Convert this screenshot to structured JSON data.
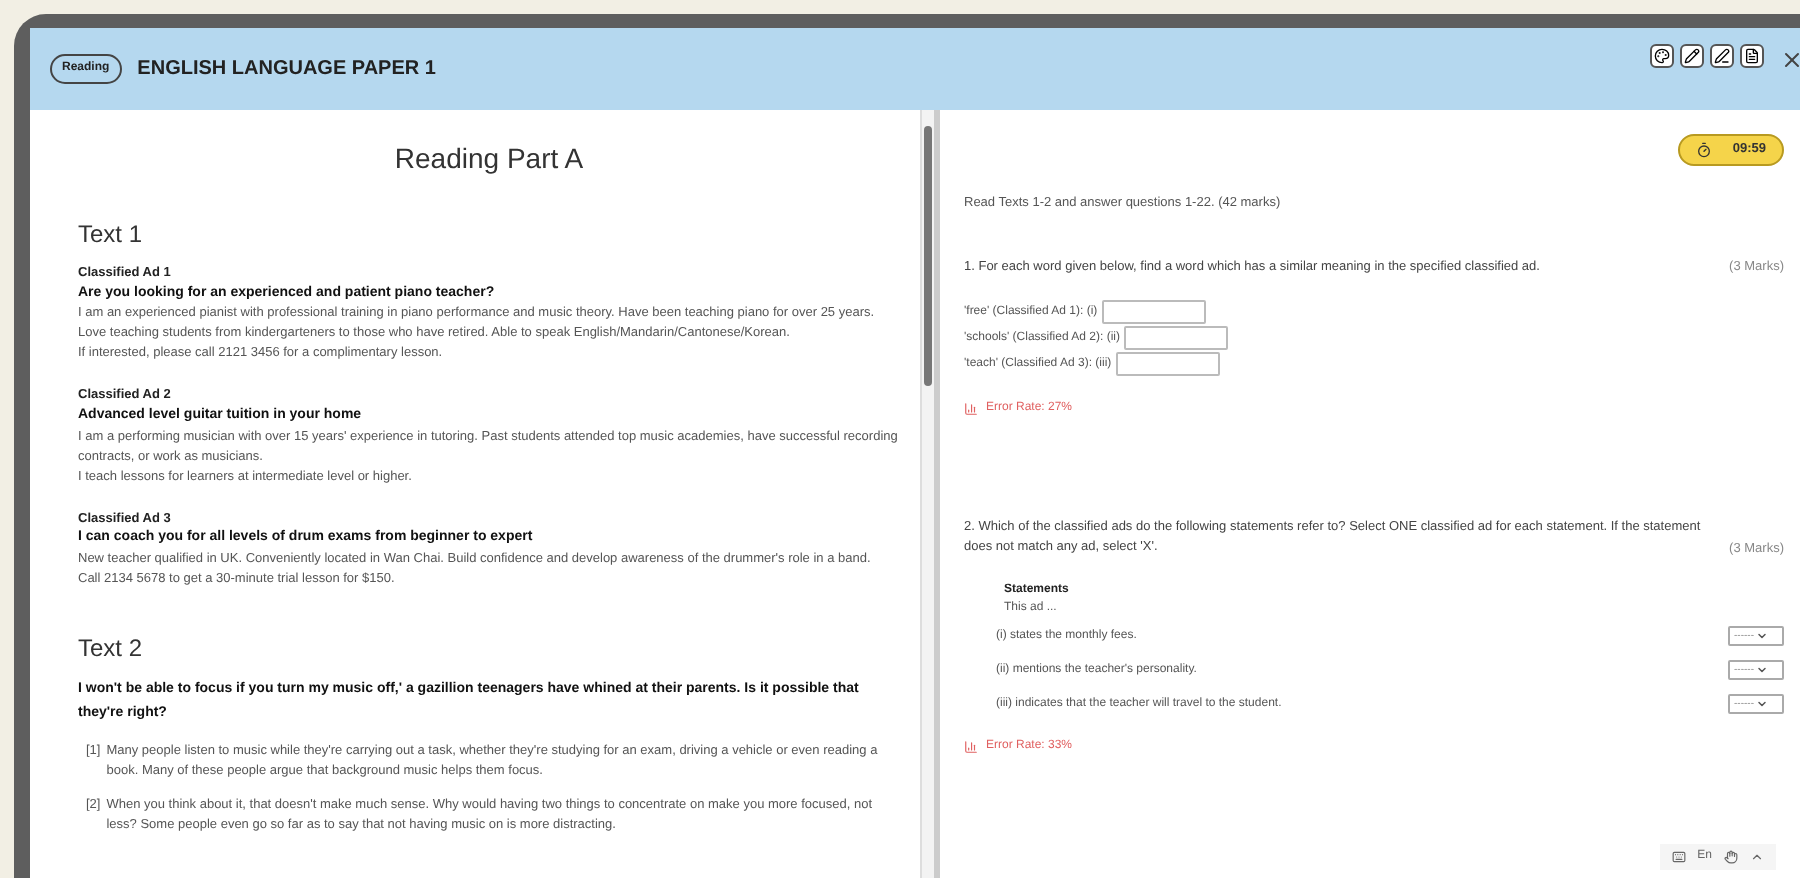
{
  "header": {
    "badge": "Reading",
    "title": "ENGLISH LANGUAGE PAPER 1"
  },
  "passage": {
    "title": "Reading Part A",
    "sections": [
      {
        "heading": "Text 1",
        "blocks": [
          {
            "kind": "ad",
            "label": "Classified Ad 1",
            "headline": "Are you looking for an experienced and patient piano teacher?",
            "lines": [
              "I am an experienced pianist with professional training in piano performance and music theory. Have been teaching piano for over 25 years. Love teaching students from kindergarteners to those who have retired. Able to speak English/Mandarin/Cantonese/Korean.",
              "If interested, please call 2121 3456 for a complimentary lesson."
            ]
          },
          {
            "kind": "ad",
            "label": "Classified Ad 2",
            "headline": "Advanced level guitar tuition in your home",
            "lines": [
              "I am a performing musician with over 15 years' experience in tutoring. Past students attended top music academies, have successful recording contracts, or work as musicians.",
              "I teach lessons for learners at intermediate level or higher."
            ]
          },
          {
            "kind": "ad",
            "label": "Classified Ad 3",
            "headline": "I can coach you for all levels of drum exams from beginner to expert",
            "lines": [
              "New teacher qualified in UK. Conveniently located in Wan Chai. Build confidence and develop awareness of the drummer's role in a band.",
              "Call 2134 5678 to get a 30-minute trial lesson for $150."
            ]
          }
        ]
      },
      {
        "heading": "Text 2",
        "blocks": [
          {
            "kind": "lead",
            "text": "I won't be able to focus if you turn my music off,' a gazillion teenagers have whined at their parents. Is it possible that they're right?"
          },
          {
            "kind": "para",
            "number": "[1]",
            "text": "Many people listen to music while they're carrying out a task, whether they're studying for an exam, driving a vehicle or even reading a book. Many of these people argue that background music helps them focus."
          },
          {
            "kind": "para",
            "number": "[2]",
            "text": "When you think about it, that doesn't make much sense. Why would having two things to concentrate on make you more focused, not less? Some people even go so far as to say that not having music on is more distracting."
          }
        ]
      }
    ]
  },
  "timer": "09:59",
  "instructions": "Read Texts 1-2 and answer questions 1-22. (42 marks)",
  "questions": [
    {
      "kind": "fill",
      "prompt": "1. For each word given below, find a word which has a similar meaning in the specified classified ad.",
      "marks": "(3 Marks)",
      "items": [
        {
          "label": "'free' (Classified Ad 1): (i)"
        },
        {
          "label": "'schools' (Classified Ad 2): (ii)"
        },
        {
          "label": "'teach' (Classified Ad 3): (iii)"
        }
      ],
      "error_rate": "Error Rate: 27%"
    },
    {
      "kind": "select",
      "prompt": "2. Which of the classified ads do the following statements refer to? Select ONE classified ad for each statement. If the statement does not match any ad, select 'X'.",
      "marks": "(3 Marks)",
      "subheading": "Statements",
      "intro": "This ad ...",
      "items": [
        {
          "label": "(i) states the monthly fees.",
          "value": "------"
        },
        {
          "label": "(ii) mentions the teacher's personality.",
          "value": "------"
        },
        {
          "label": "(iii) indicates that the teacher will travel to the student.",
          "value": "------"
        }
      ],
      "error_rate": "Error Rate: 33%"
    }
  ],
  "input_toolbar": {
    "language": "En"
  }
}
